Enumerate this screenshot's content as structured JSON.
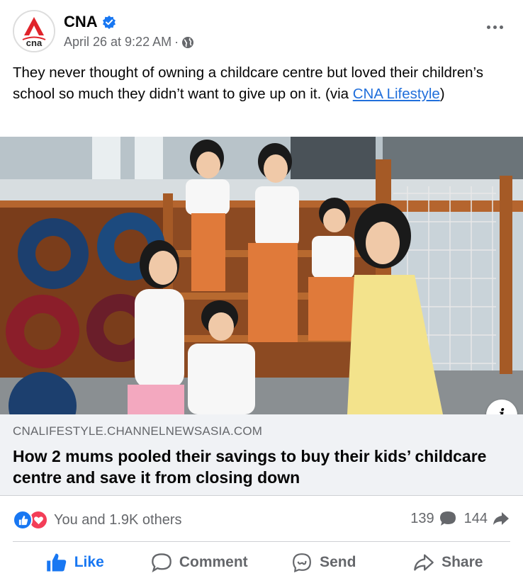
{
  "post": {
    "page_name": "CNA",
    "timestamp": "April 26 at 9:22 AM",
    "separator": "·",
    "text_before": "They never thought of owning a childcare centre but loved their children’s school so much they didn’t want to give up on it. (via ",
    "link_text": "CNA Lifestyle",
    "text_after": ")",
    "avatar_logo": "cna"
  },
  "link_card": {
    "domain": "CNALIFESTYLE.CHANNELNEWSASIA.COM",
    "title": "How 2 mums pooled their savings to buy their kids’ childcare centre and save it from closing down"
  },
  "stats": {
    "reactions_text": "You and 1.9K others",
    "comments_count": "139",
    "shares_count": "144"
  },
  "actions": {
    "like": "Like",
    "comment": "Comment",
    "send": "Send",
    "share": "Share"
  },
  "icons": {
    "verified": "verified-badge-icon",
    "audience": "globe-icon",
    "more": "more-options-icon",
    "info": "info-icon"
  },
  "colors": {
    "accent": "#1877f2",
    "love": "#f33e58",
    "brand_red": "#e0242b",
    "muted": "#65676b"
  }
}
